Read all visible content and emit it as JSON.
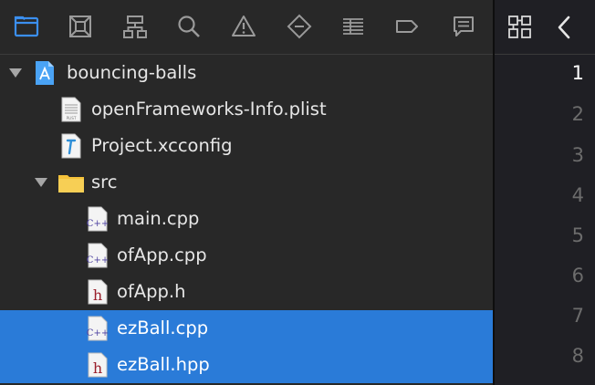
{
  "toolbar": {
    "icons": [
      "project-navigator-icon",
      "source-control-navigator-icon",
      "symbol-navigator-icon",
      "find-navigator-icon",
      "issue-navigator-icon",
      "test-navigator-icon",
      "debug-navigator-icon",
      "breakpoint-navigator-icon",
      "report-navigator-icon"
    ],
    "active_icon": "project-navigator-icon",
    "active_color": "#3b8ff0"
  },
  "tree": {
    "project": {
      "label": "bouncing-balls",
      "expanded": true
    },
    "files": [
      {
        "label": "openFrameworks-Info.plist",
        "kind": "plist"
      },
      {
        "label": "Project.xcconfig",
        "kind": "xcconfig"
      }
    ],
    "src_folder": {
      "label": "src",
      "expanded": true
    },
    "src_files": [
      {
        "label": "main.cpp",
        "kind": "cpp",
        "selected": false
      },
      {
        "label": "ofApp.cpp",
        "kind": "cpp",
        "selected": false
      },
      {
        "label": "ofApp.h",
        "kind": "h",
        "selected": false
      },
      {
        "label": "ezBall.cpp",
        "kind": "cpp",
        "selected": true
      },
      {
        "label": "ezBall.hpp",
        "kind": "h",
        "selected": true
      }
    ],
    "selection_color": "#2a7bd8"
  },
  "editor": {
    "line_numbers": [
      "1",
      "2",
      "3",
      "4",
      "5",
      "6",
      "7",
      "8"
    ],
    "current_line": "1"
  },
  "file_icon_glyphs": {
    "cpp": "C++",
    "h": "h",
    "plist": "PLIST"
  }
}
